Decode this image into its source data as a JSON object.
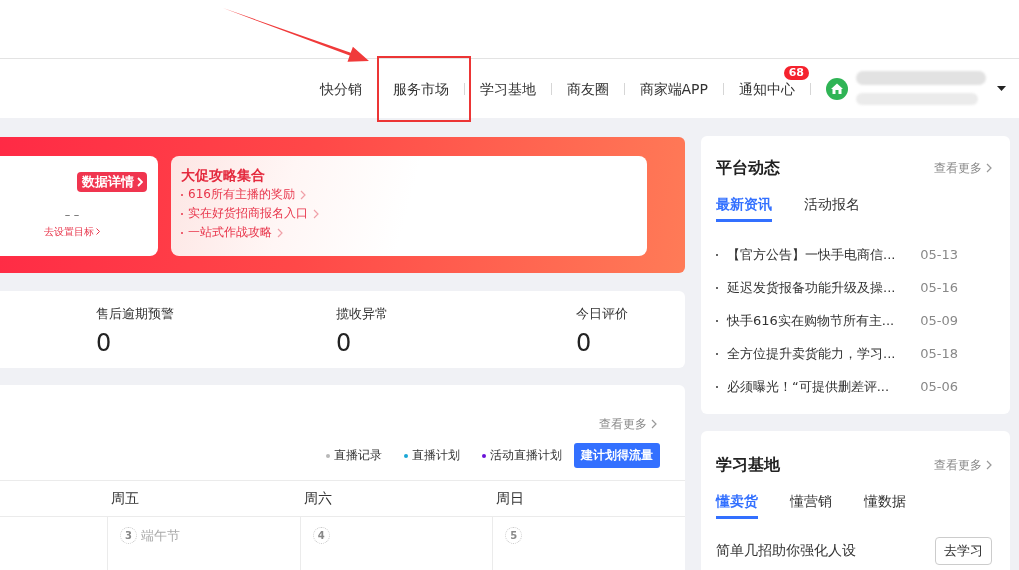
{
  "header": {
    "nav": [
      {
        "label": "快分销",
        "highlighted": false
      },
      {
        "label": "服务市场",
        "highlighted": true
      },
      {
        "label": "学习基地",
        "highlighted": false
      },
      {
        "label": "商友圈",
        "highlighted": false
      },
      {
        "label": "商家端APP",
        "highlighted": false
      },
      {
        "label": "通知中心",
        "highlighted": false,
        "badge": "68"
      }
    ]
  },
  "banner": {
    "data_button": "数据详情",
    "target_value": "– –",
    "target_link": "去设置目标",
    "promo": {
      "title": "大促攻略集合",
      "links": [
        "616所有主播的奖励",
        "实在好货招商报名入口",
        "一站式作战攻略"
      ]
    }
  },
  "stats": [
    {
      "label": "售后逾期预警",
      "value": "0"
    },
    {
      "label": "揽收异常",
      "value": "0"
    },
    {
      "label": "今日评价",
      "value": "0"
    }
  ],
  "schedule": {
    "more_link": "查看更多",
    "legend": [
      {
        "label": "直播记录",
        "color": "#b8b8b8"
      },
      {
        "label": "直播计划",
        "color": "#1aa7d6"
      },
      {
        "label": "活动直播计划",
        "color": "#6a12d8"
      }
    ],
    "create_button": "建计划得流量",
    "days": [
      {
        "weekday": "周五",
        "date": "3",
        "holiday": "端午节"
      },
      {
        "weekday": "周六",
        "date": "4"
      },
      {
        "weekday": "周日",
        "date": "5"
      }
    ]
  },
  "platform_news": {
    "title": "平台动态",
    "more_link": "查看更多",
    "tabs": [
      {
        "label": "最新资讯",
        "selected": true
      },
      {
        "label": "活动报名",
        "selected": false
      }
    ],
    "items": [
      {
        "title": "【官方公告】一快手电商信...",
        "date": "05-13"
      },
      {
        "title": "延迟发货报备功能升级及操...",
        "date": "05-16"
      },
      {
        "title": "快手616实在购物节所有主...",
        "date": "05-09"
      },
      {
        "title": "全方位提升卖货能力，学习...",
        "date": "05-18"
      },
      {
        "title": "必须曝光！“可提供删差评...",
        "date": "05-06"
      }
    ]
  },
  "learning": {
    "title": "学习基地",
    "more_link": "查看更多",
    "tabs": [
      {
        "label": "懂卖货",
        "selected": true
      },
      {
        "label": "懂营销",
        "selected": false
      },
      {
        "label": "懂数据",
        "selected": false
      }
    ],
    "items": [
      {
        "title": "简单几招助你强化人设",
        "button": "去学习"
      }
    ]
  }
}
